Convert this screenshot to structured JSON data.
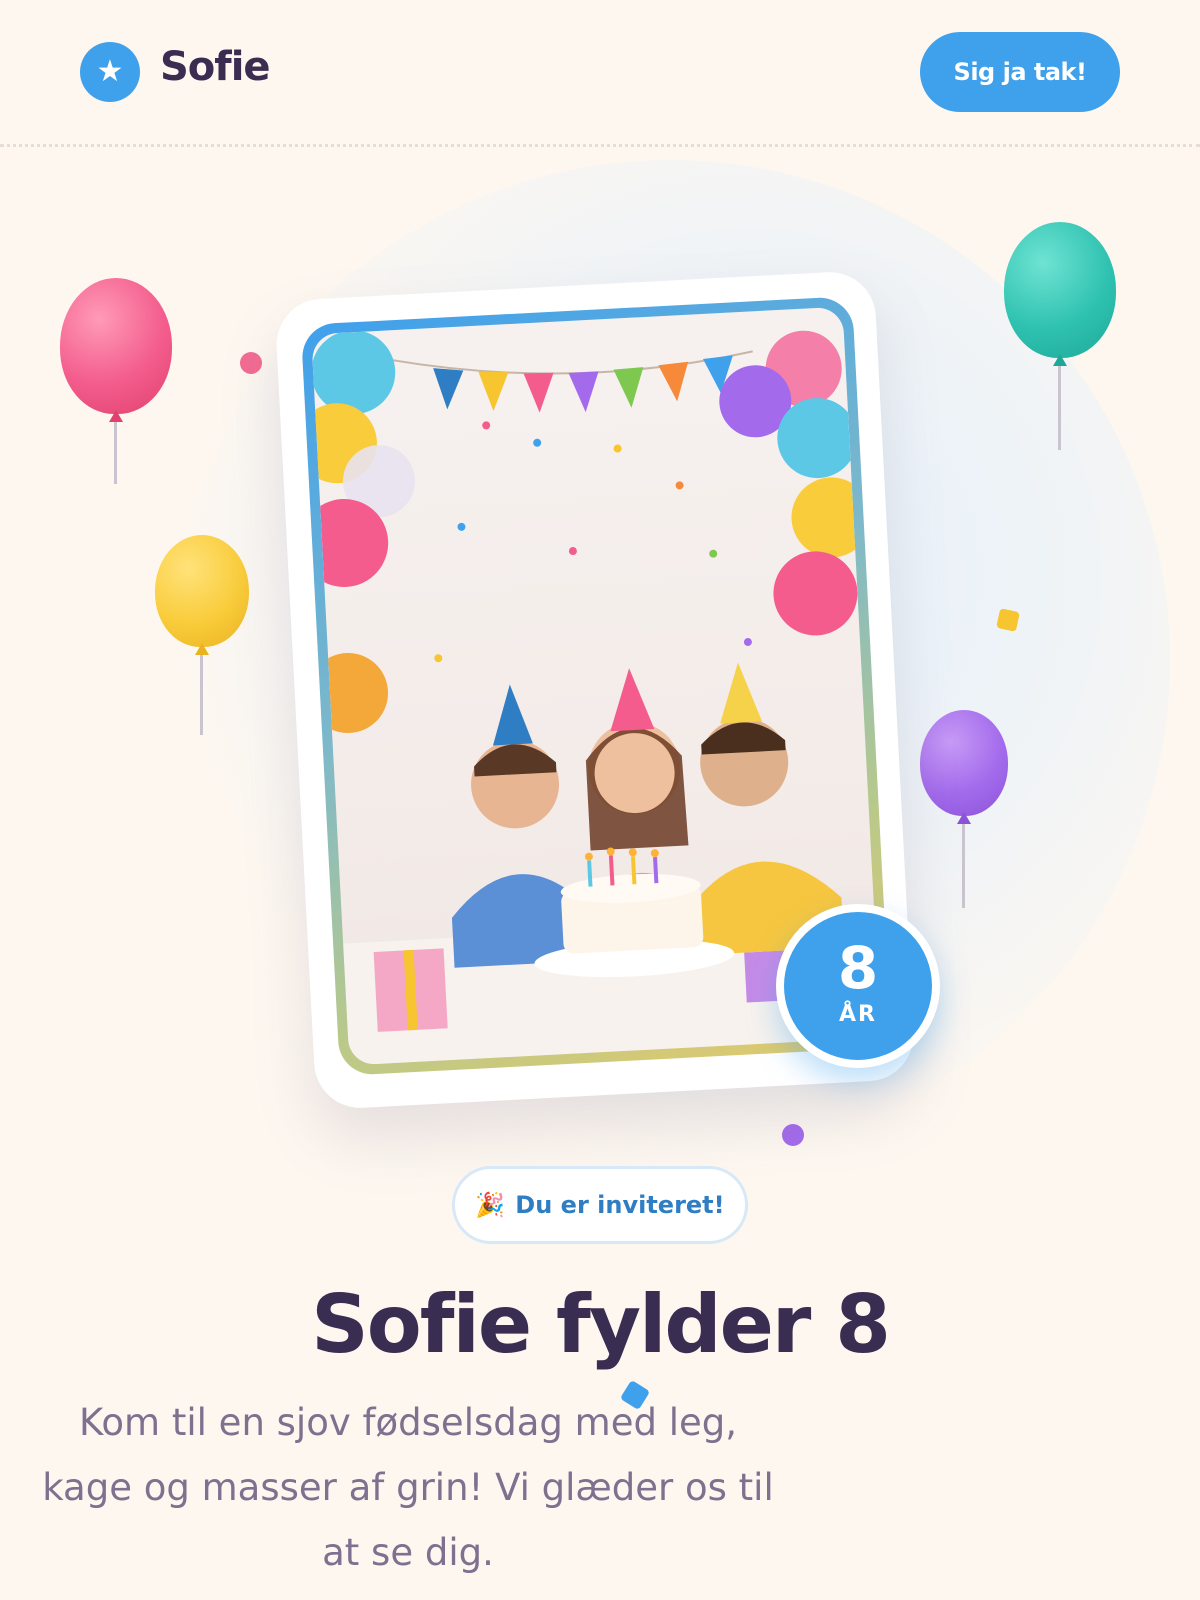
{
  "header": {
    "logo_icon": "star-icon",
    "logo_glyph": "★",
    "brand_name": "Sofie",
    "rsvp_label": "Sig ja tak!"
  },
  "hero": {
    "age_number": "8",
    "age_unit": "ÅR",
    "invite_emoji": "🎉",
    "invite_label": "Du er inviteret!",
    "headline": "Sofie fylder 8",
    "lead": "Kom til en sjov fødselsdag med leg, kage og masser af grin! Vi glæder os til at se dig."
  },
  "colors": {
    "accent": "#3fa0ec",
    "text_dark": "#3a2d52",
    "text_muted": "#7c7290",
    "background": "#fdf7f0",
    "balloon_pink": "#f35c8c",
    "balloon_yellow": "#f9cc3b",
    "balloon_teal": "#2fc2b0",
    "balloon_purple": "#a36bec"
  }
}
